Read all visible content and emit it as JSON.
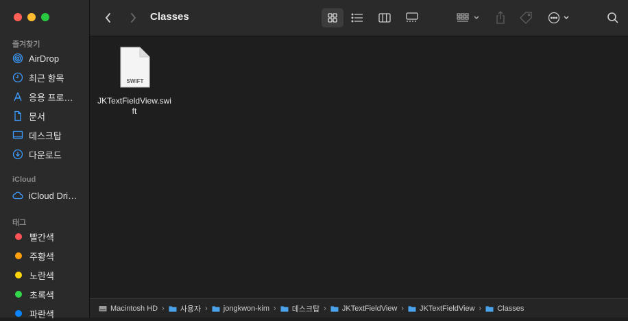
{
  "window": {
    "title": "Classes"
  },
  "sidebar": {
    "favorites_title": "즐겨찾기",
    "favorites": [
      {
        "label": "AirDrop",
        "icon": "airdrop-icon"
      },
      {
        "label": "최근 항목",
        "icon": "clock-icon"
      },
      {
        "label": "응용 프로…",
        "icon": "applications-icon"
      },
      {
        "label": "문서",
        "icon": "document-icon"
      },
      {
        "label": "데스크탑",
        "icon": "desktop-icon"
      },
      {
        "label": "다운로드",
        "icon": "download-icon"
      }
    ],
    "icloud_title": "iCloud",
    "icloud": [
      {
        "label": "iCloud Dri…",
        "icon": "cloud-icon"
      }
    ],
    "tags_title": "태그",
    "tags": [
      {
        "label": "빨간색",
        "color": "#ff5257"
      },
      {
        "label": "주황색",
        "color": "#ff9f0a"
      },
      {
        "label": "노란색",
        "color": "#ffd60a"
      },
      {
        "label": "초록색",
        "color": "#32d74b"
      },
      {
        "label": "파란색",
        "color": "#0a84ff"
      }
    ]
  },
  "toolbar": {
    "back": "chevron-left-icon",
    "forward": "chevron-right-icon",
    "views": [
      "grid-view-icon",
      "list-view-icon",
      "column-view-icon",
      "gallery-view-icon"
    ],
    "active_view": "grid-view-icon",
    "group": "group-icon",
    "share": "share-icon",
    "tag": "tag-icon",
    "more": "ellipsis-icon",
    "search": "search-icon"
  },
  "files": [
    {
      "name": "JKTextFieldView.swift",
      "badge": "SWIFT"
    }
  ],
  "pathbar": [
    {
      "label": "Macintosh HD",
      "icon": "disk-icon"
    },
    {
      "label": "사용자",
      "icon": "folder-icon"
    },
    {
      "label": "jongkwon-kim",
      "icon": "folder-icon"
    },
    {
      "label": "데스크탑",
      "icon": "folder-icon"
    },
    {
      "label": "JKTextFieldView",
      "icon": "folder-icon"
    },
    {
      "label": "JKTextFieldView",
      "icon": "folder-icon"
    },
    {
      "label": "Classes",
      "icon": "folder-icon"
    }
  ]
}
